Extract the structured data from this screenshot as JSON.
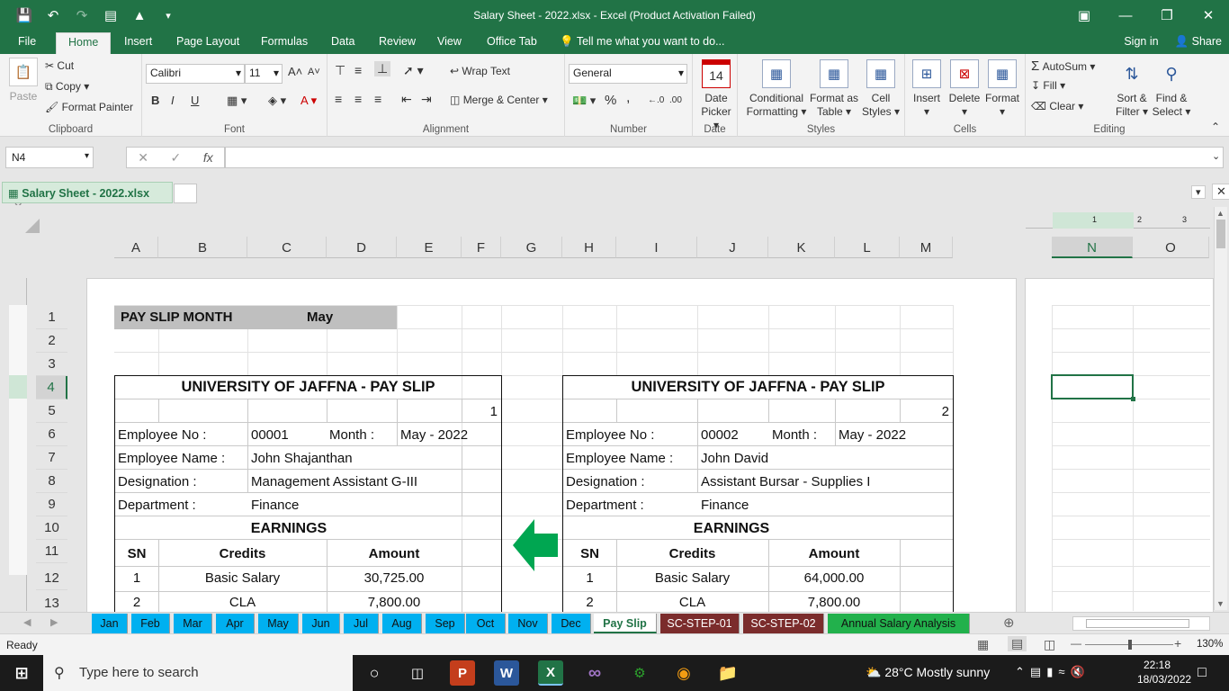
{
  "window": {
    "title": "Salary Sheet - 2022.xlsx - Excel (Product Activation Failed)"
  },
  "menu": {
    "tabs": [
      "File",
      "Home",
      "Insert",
      "Page Layout",
      "Formulas",
      "Data",
      "Review",
      "View",
      "Office Tab"
    ],
    "tell_me": "Tell me what you want to do...",
    "sign_in": "Sign in",
    "share": "Share"
  },
  "ribbon": {
    "clipboard": {
      "paste": "Paste",
      "cut": "Cut",
      "copy": "Copy",
      "format_painter": "Format Painter",
      "label": "Clipboard"
    },
    "font": {
      "family": "Calibri",
      "size": "11",
      "label": "Font",
      "bold": "B",
      "italic": "I",
      "underline": "U"
    },
    "alignment": {
      "wrap": "Wrap Text",
      "merge": "Merge & Center",
      "label": "Alignment"
    },
    "number": {
      "format": "General",
      "label": "Number",
      "percent": "%",
      "comma": ","
    },
    "date": {
      "icon_num": "14",
      "line1": "Date",
      "line2": "Picker",
      "label": "Date"
    },
    "styles": {
      "cond1": "Conditional",
      "cond2": "Formatting",
      "fmt1": "Format as",
      "fmt2": "Table",
      "cell1": "Cell",
      "cell2": "Styles",
      "label": "Styles"
    },
    "cells": {
      "insert": "Insert",
      "delete": "Delete",
      "format": "Format",
      "label": "Cells"
    },
    "editing": {
      "autosum": "AutoSum",
      "fill": "Fill",
      "clear": "Clear",
      "sort1": "Sort &",
      "sort2": "Filter",
      "find1": "Find &",
      "find2": "Select",
      "label": "Editing"
    }
  },
  "formula_bar": {
    "name_box": "N4",
    "fx": "fx",
    "value": ""
  },
  "workbook_tab": "Salary Sheet - 2022.xlsx",
  "columns": [
    "A",
    "B",
    "C",
    "D",
    "E",
    "F",
    "G",
    "H",
    "I",
    "J",
    "K",
    "L",
    "M",
    "N",
    "O"
  ],
  "rows": [
    "1",
    "2",
    "3",
    "4",
    "5",
    "6",
    "7",
    "8",
    "9",
    "10",
    "11",
    "12",
    "13"
  ],
  "sheet": {
    "pay_slip_month_label": "PAY SLIP MONTH",
    "pay_slip_month_value": "May",
    "slips": [
      {
        "title": "UNIVERSITY OF JAFFNA - PAY SLIP",
        "index": "1",
        "employee_no_label": "Employee No :",
        "employee_no": "00001",
        "month_label": "Month :",
        "month": "May - 2022",
        "name_label": "Employee Name :",
        "name": "John Shajanthan",
        "designation_label": "Designation :",
        "designation": "Management Assistant G-III",
        "department_label": "Department :",
        "department": "Finance",
        "earnings": "EARNINGS",
        "hdr_sn": "SN",
        "hdr_credits": "Credits",
        "hdr_amount": "Amount",
        "items": [
          {
            "sn": "1",
            "credit": "Basic Salary",
            "amount": "30,725.00"
          },
          {
            "sn": "2",
            "credit": "CLA",
            "amount": "7,800.00"
          }
        ]
      },
      {
        "title": "UNIVERSITY OF JAFFNA - PAY SLIP",
        "index": "2",
        "employee_no_label": "Employee No :",
        "employee_no": "00002",
        "month_label": "Month :",
        "month": "May - 2022",
        "name_label": "Employee Name :",
        "name": "John David",
        "designation_label": "Designation :",
        "designation": "Assistant Bursar - Supplies I",
        "department_label": "Department :",
        "department": "Finance",
        "earnings": "EARNINGS",
        "hdr_sn": "SN",
        "hdr_credits": "Credits",
        "hdr_amount": "Amount",
        "items": [
          {
            "sn": "1",
            "credit": "Basic Salary",
            "amount": "64,000.00"
          },
          {
            "sn": "2",
            "credit": "CLA",
            "amount": "7,800.00"
          }
        ]
      }
    ]
  },
  "sheet_tabs": [
    "Jan",
    "Feb",
    "Mar",
    "Apr",
    "May",
    "Jun",
    "Jul",
    "Aug",
    "Sep",
    "Oct",
    "Nov",
    "Dec",
    "Pay Slip",
    "SC-STEP-01",
    "SC-STEP-02",
    "Annual Salary Analysis"
  ],
  "status": {
    "ready": "Ready",
    "zoom": "130%"
  },
  "taskbar": {
    "search": "Type here to search",
    "weather": "28°C  Mostly sunny",
    "time": "22:18",
    "date": "18/03/2022"
  },
  "colors": {
    "excel_green": "#217346",
    "tab_cyan": "#00b0f0",
    "tab_maroon": "#7b2c2c",
    "tab_green": "#22b14c",
    "arrow_green": "#00a651"
  }
}
